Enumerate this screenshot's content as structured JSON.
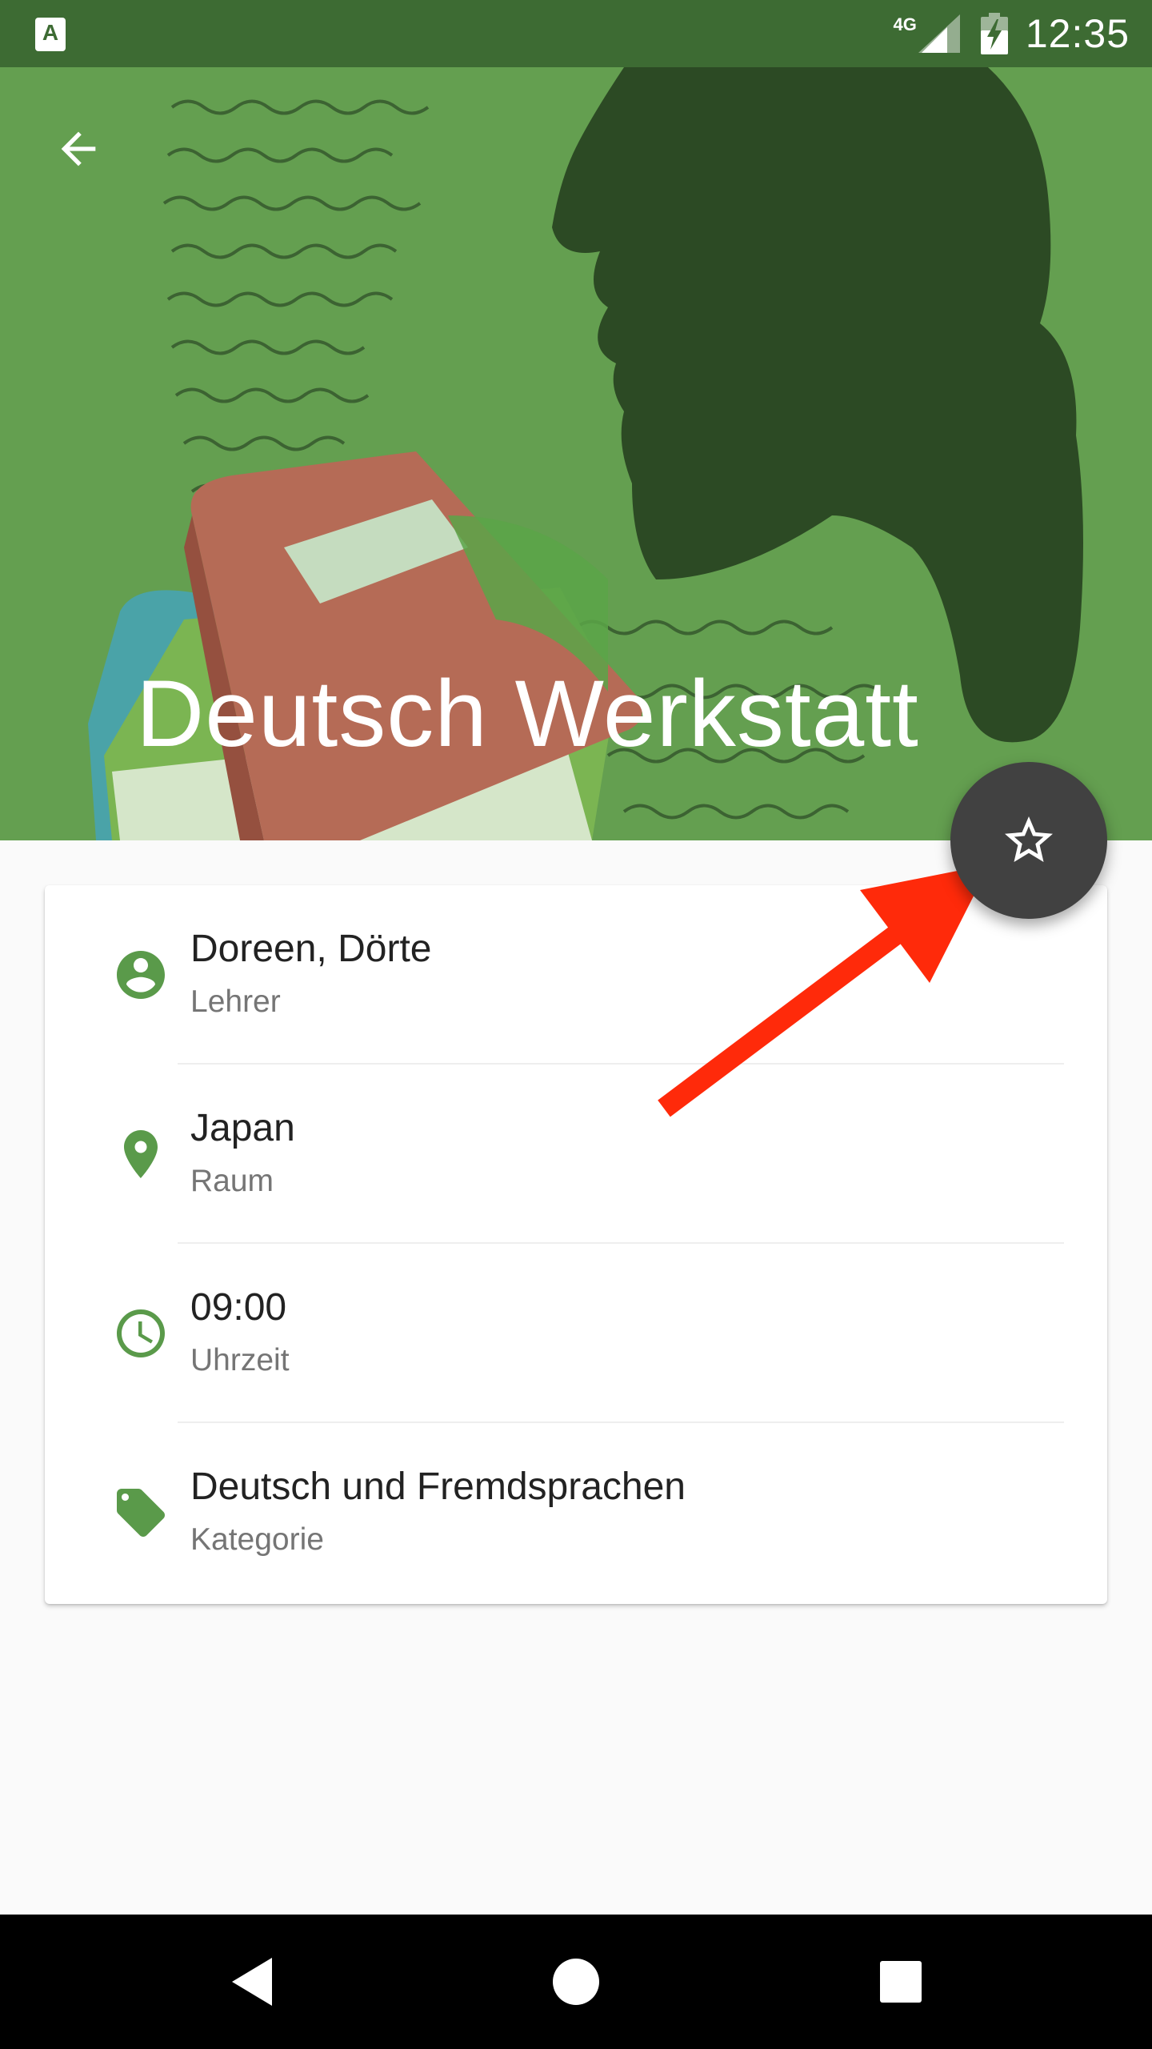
{
  "statusbar": {
    "app_icon_letter": "A",
    "network": "4G",
    "time": "12:35",
    "icons": [
      "app-notification-icon",
      "signal-icon",
      "battery-icon"
    ]
  },
  "header": {
    "title": "Deutsch Werkstatt",
    "back_icon": "arrow-back-icon",
    "accent_color": "#649f50",
    "statusbar_color": "#3d6b33"
  },
  "fab": {
    "icon": "star-outline-icon",
    "color": "#414141"
  },
  "details": {
    "items": [
      {
        "primary": "Doreen, Dörte",
        "secondary": "Lehrer",
        "icon": "person-icon"
      },
      {
        "primary": "Japan",
        "secondary": "Raum",
        "icon": "location-pin-icon"
      },
      {
        "primary": "09:00",
        "secondary": "Uhrzeit",
        "icon": "clock-icon"
      },
      {
        "primary": "Deutsch und Fremdsprachen",
        "secondary": "Kategorie",
        "icon": "tag-icon"
      }
    ],
    "icon_color": "#5a9a4a"
  },
  "annotation": {
    "color": "#ff2a0a"
  },
  "navbar": {
    "icons": [
      "back-triangle-icon",
      "home-circle-icon",
      "recents-square-icon"
    ]
  }
}
